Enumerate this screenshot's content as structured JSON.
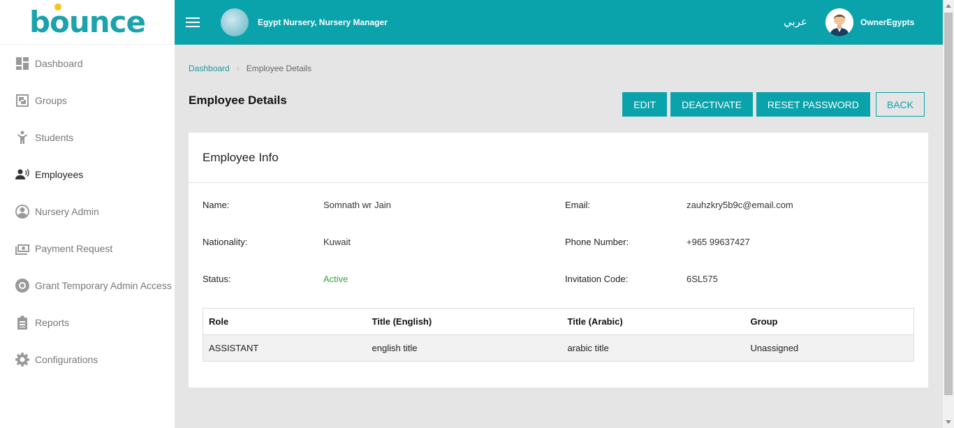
{
  "sidebar": {
    "logo_text": "bounce",
    "items": [
      {
        "label": "Dashboard",
        "icon": "dashboard-icon"
      },
      {
        "label": "Groups",
        "icon": "groups-icon"
      },
      {
        "label": "Students",
        "icon": "student-icon"
      },
      {
        "label": "Employees",
        "icon": "employees-icon"
      },
      {
        "label": "Nursery Admin",
        "icon": "person-circle-icon"
      },
      {
        "label": "Payment Request",
        "icon": "money-icon"
      },
      {
        "label": "Grant Temporary Admin Access",
        "icon": "lifebuoy-icon"
      },
      {
        "label": "Reports",
        "icon": "clipboard-icon"
      },
      {
        "label": "Configurations",
        "icon": "gear-icon"
      }
    ],
    "active": "Employees"
  },
  "header": {
    "nursery_name": "Egypt Nursery, Nursery Manager",
    "language_toggle": "عربي",
    "user_name": "OwnerEgypts",
    "color": "#0aa2ab"
  },
  "breadcrumb": {
    "home": "Dashboard",
    "current": "Employee Details"
  },
  "page": {
    "title": "Employee Details",
    "actions": {
      "edit": "EDIT",
      "deactivate": "DEACTIVATE",
      "reset_password": "RESET PASSWORD",
      "back": "BACK"
    }
  },
  "employee_info": {
    "title": "Employee Info",
    "fields": {
      "name_label": "Name:",
      "name": "Somnath wr Jain",
      "email_label": "Email:",
      "email": "zauhzkry5b9c@email.com",
      "nationality_label": "Nationality:",
      "nationality": "Kuwait",
      "phone_label": "Phone Number:",
      "phone": "+965 99637427",
      "status_label": "Status:",
      "status": "Active",
      "status_color": "#3aa33a",
      "invitation_label": "Invitation Code:",
      "invitation_code": "6SL575"
    },
    "table": {
      "headers": [
        "Role",
        "Title (English)",
        "Title (Arabic)",
        "Group"
      ],
      "rows": [
        [
          "ASSISTANT",
          "english title",
          "arabic title",
          "Unassigned"
        ]
      ]
    }
  }
}
